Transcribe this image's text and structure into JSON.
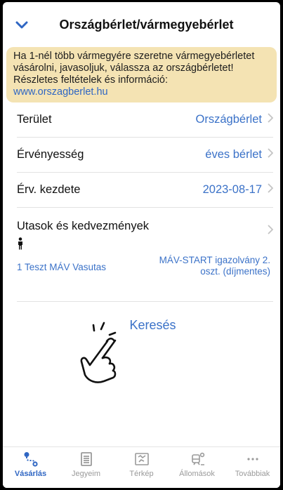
{
  "header": {
    "title": "Országbérlet/vármegyebérlet"
  },
  "notice": {
    "text": "Ha 1-nél több vármegyére szeretne vármegyebérletet vásárolni, javasoljuk, válassza az országbérletet! Részletes feltételek és információ:",
    "link": "www.orszagberlet.hu"
  },
  "rows": [
    {
      "label": "Terület",
      "value": "Országbérlet"
    },
    {
      "label": "Érvényesség",
      "value": "éves bérlet"
    },
    {
      "label": "Érv. kezdete",
      "value": "2023-08-17"
    }
  ],
  "passengers": {
    "label": "Utasok és kedvezmények",
    "name": "1 Teszt MÁV Vasutas",
    "discount": "MÁV-START igazolvány 2. oszt. (díjmentes)"
  },
  "search": {
    "label": "Keresés"
  },
  "tabs": [
    {
      "label": "Vásárlás",
      "icon": "route-icon",
      "active": true
    },
    {
      "label": "Jegyeim",
      "icon": "ticket-icon",
      "active": false
    },
    {
      "label": "Térkép",
      "icon": "map-icon",
      "active": false
    },
    {
      "label": "Állomások",
      "icon": "train-station-icon",
      "active": false
    },
    {
      "label": "Továbbiak",
      "icon": "more-icon",
      "active": false
    }
  ],
  "colors": {
    "accent": "#3b72c8",
    "notice_bg": "#f4e3b3"
  }
}
